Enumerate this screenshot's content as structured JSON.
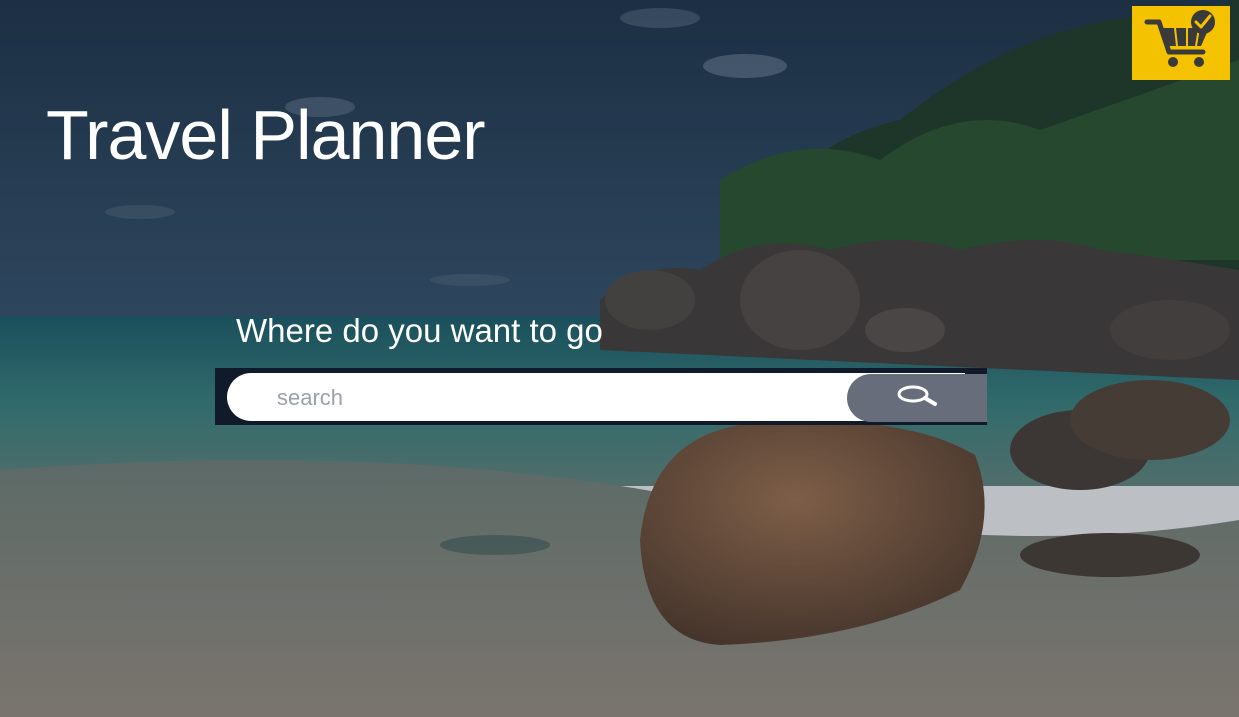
{
  "header": {
    "title": "Travel Planner"
  },
  "search": {
    "prompt": "Where do you want to go",
    "placeholder": "search"
  },
  "icons": {
    "cart": "shopping-cart-check-icon",
    "search": "magnifier-icon"
  },
  "colors": {
    "cart_accent": "#f5c200",
    "search_button": "#676d7b",
    "search_bar_bg": "#101a2a"
  }
}
